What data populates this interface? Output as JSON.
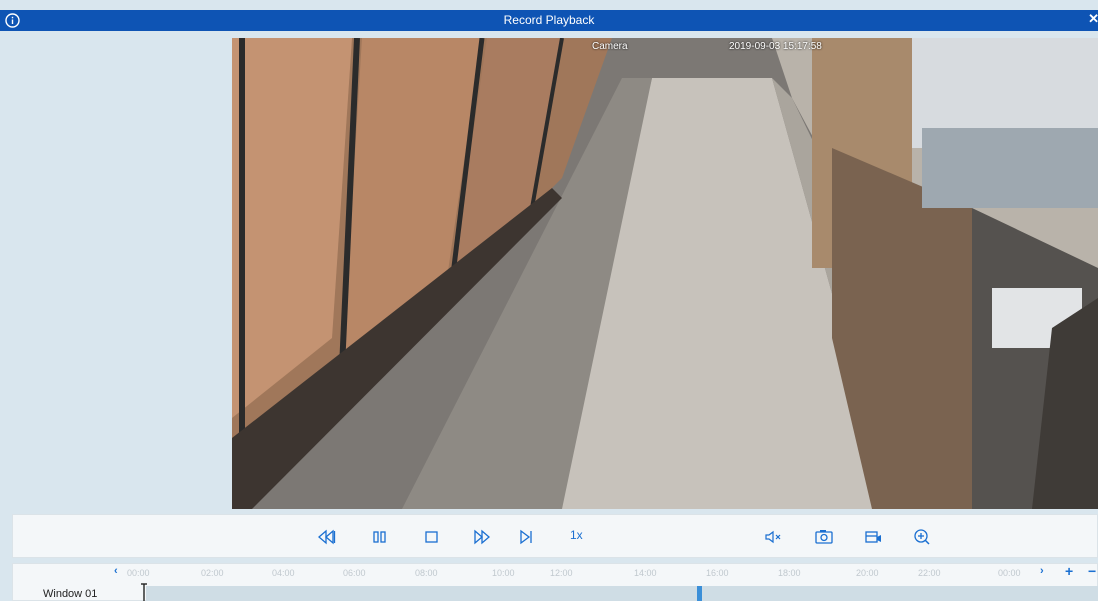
{
  "window": {
    "title": "Record Playback"
  },
  "icons": {
    "info": "info-icon",
    "close": "close-icon"
  },
  "video": {
    "camera_label": "Camera",
    "timestamp": "2019-09-03 15:17:58"
  },
  "controls": {
    "speed_label": "1x",
    "buttons": [
      "rewind",
      "pause",
      "stop",
      "fast-forward",
      "next-frame",
      "mute",
      "snapshot",
      "record-clip",
      "digital-zoom"
    ]
  },
  "timeline": {
    "ticks": [
      "00:00",
      "02:00",
      "04:00",
      "06:00",
      "08:00",
      "10:00",
      "12:00",
      "14:00",
      "16:00",
      "18:00",
      "20:00",
      "22:00",
      "00:00"
    ],
    "window_label": "Window 01",
    "nav_prev": "‹",
    "nav_next": "›",
    "zoom_in": "+",
    "zoom_out": "−"
  },
  "colors": {
    "title_bar": "#0e54b4",
    "accent": "#1a6fd1",
    "background": "#d9e6ee"
  }
}
